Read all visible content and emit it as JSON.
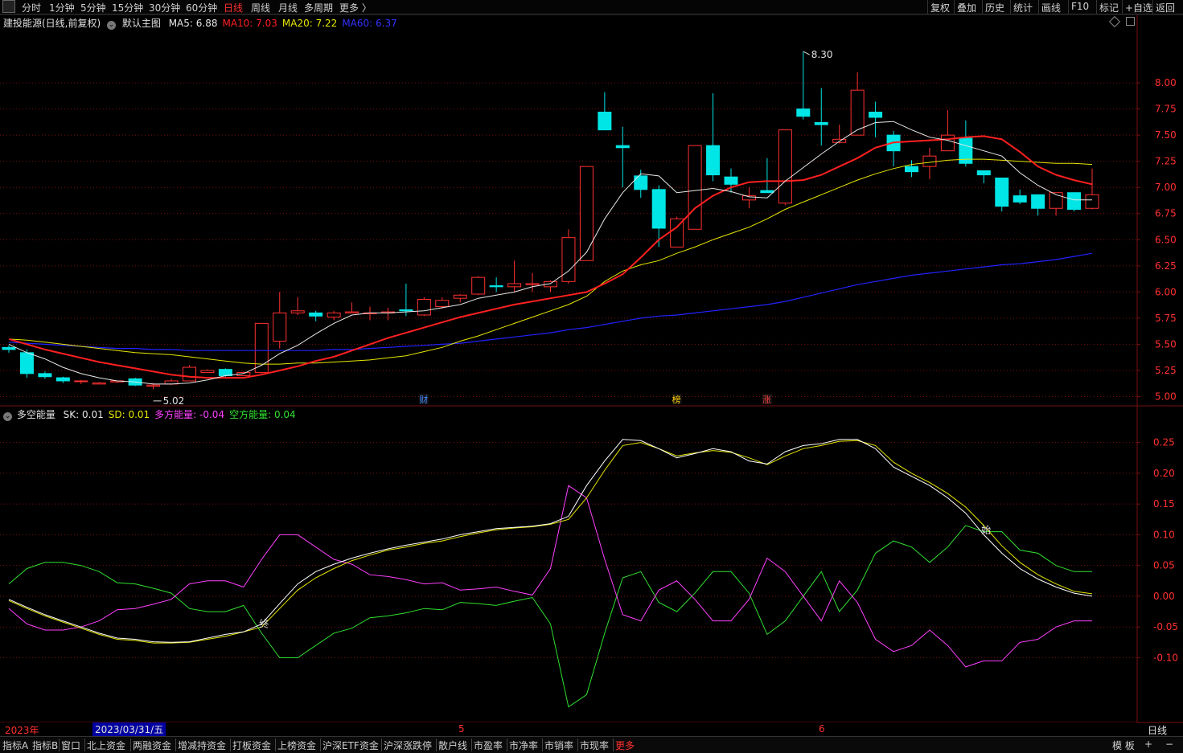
{
  "toolbar": {
    "left_tabs": [
      "分时",
      "1分钟",
      "5分钟",
      "15分钟",
      "30分钟",
      "60分钟",
      "日线",
      "周线",
      "月线",
      "多周期",
      "更多 〉"
    ],
    "active_tab": "日线",
    "right_tabs": [
      "复权",
      "叠加",
      "历史",
      "统计",
      "画线",
      "F10",
      "标记",
      "+自选",
      "返回"
    ]
  },
  "main": {
    "stock_name": "建投能源(日线,前复权)",
    "template": "默认主图",
    "ma": [
      {
        "label": "MA5: 6.88",
        "color": "#e8e8e8"
      },
      {
        "label": "MA10: 7.03",
        "color": "#ff2020"
      },
      {
        "label": "MA20: 7.22",
        "color": "#e6e600"
      },
      {
        "label": "MA60: 6.37",
        "color": "#3333ff"
      }
    ],
    "high_label": "8.30",
    "low_label": "5.02",
    "markers": [
      {
        "text": "财",
        "color": "#4488ff"
      },
      {
        "text": "榜",
        "color": "#ffcc00"
      },
      {
        "text": "涨",
        "color": "#ff4040"
      }
    ]
  },
  "sub": {
    "title": "多空能量",
    "items": [
      {
        "label": "SK: 0.01",
        "color": "#e8e8e8"
      },
      {
        "label": "SD: 0.01",
        "color": "#e6e600"
      },
      {
        "label": "多方能量: -0.04",
        "color": "#ff40ff"
      },
      {
        "label": "空方能量: 0.04",
        "color": "#30e030"
      }
    ],
    "annotations": [
      "终",
      "始"
    ]
  },
  "date_axis": {
    "year": "2023年",
    "cursor_date": "2023/03/31/五",
    "months": [
      "5",
      "6"
    ],
    "period": "日线"
  },
  "bottombar": {
    "items": [
      "指标A",
      "指标B",
      "窗口",
      "北上资金",
      "两融资金",
      "增减持资金",
      "打板资金",
      "上榜资金",
      "沪深ETF资金",
      "沪深涨跌停",
      "散户线",
      "市盈率",
      "市净率",
      "市销率",
      "市现率",
      "更多"
    ],
    "right": [
      "模 板",
      "+",
      "−"
    ]
  },
  "colors": {
    "up": "#ff3030",
    "down": "#00e5e5",
    "grid": "#7a1010",
    "axis_text": "#ff3030",
    "ma5": "#e8e8e8",
    "ma10": "#ff2020",
    "ma20": "#e6e600",
    "ma60": "#2222ff",
    "sk": "#ffffff",
    "sd": "#e6e600",
    "bull": "#ff40ff",
    "bear": "#30e030"
  },
  "chart_data": [
    {
      "type": "candlestick",
      "title": "建投能源(日线,前复权)",
      "y_ticks": [
        8.0,
        7.75,
        7.5,
        7.25,
        7.0,
        6.75,
        6.5,
        6.25,
        6.0,
        5.75,
        5.5,
        5.25,
        5.0
      ],
      "ylim": [
        4.95,
        8.5
      ],
      "candles": [
        [
          5.47,
          5.45,
          5.49,
          5.42
        ],
        [
          5.42,
          5.22,
          5.45,
          5.18
        ],
        [
          5.22,
          5.19,
          5.24,
          5.17
        ],
        [
          5.18,
          5.15,
          5.19,
          5.13
        ],
        [
          5.15,
          5.15,
          5.16,
          5.12
        ],
        [
          5.12,
          5.13,
          5.14,
          5.12
        ],
        [
          5.14,
          5.15,
          5.15,
          5.13
        ],
        [
          5.17,
          5.11,
          5.18,
          5.1
        ],
        [
          5.1,
          5.11,
          5.13,
          5.07
        ],
        [
          5.12,
          5.15,
          5.17,
          5.11
        ],
        [
          5.15,
          5.28,
          5.3,
          5.15
        ],
        [
          5.23,
          5.25,
          5.26,
          5.23
        ],
        [
          5.26,
          5.2,
          5.27,
          5.19
        ],
        [
          5.2,
          5.23,
          5.24,
          5.2
        ],
        [
          5.23,
          5.7,
          5.7,
          5.22
        ],
        [
          5.53,
          5.8,
          6.0,
          5.46
        ],
        [
          5.8,
          5.82,
          5.95,
          5.78
        ],
        [
          5.8,
          5.77,
          5.82,
          5.72
        ],
        [
          5.76,
          5.8,
          5.82,
          5.73
        ],
        [
          5.8,
          5.81,
          5.9,
          5.8
        ],
        [
          5.8,
          5.8,
          5.86,
          5.73
        ],
        [
          5.8,
          5.81,
          5.85,
          5.73
        ],
        [
          5.83,
          5.82,
          6.08,
          5.77
        ],
        [
          5.78,
          5.93,
          5.95,
          5.77
        ],
        [
          5.86,
          5.92,
          5.95,
          5.84
        ],
        [
          5.94,
          5.97,
          5.98,
          5.9
        ],
        [
          5.98,
          6.14,
          6.15,
          5.97
        ],
        [
          6.06,
          6.05,
          6.14,
          6.0
        ],
        [
          6.05,
          6.08,
          6.3,
          6.0
        ],
        [
          6.07,
          6.08,
          6.18,
          6.0
        ],
        [
          6.05,
          6.1,
          6.11,
          6.0
        ],
        [
          6.1,
          6.52,
          6.6,
          6.08
        ],
        [
          6.3,
          7.2,
          7.2,
          6.3
        ],
        [
          7.72,
          7.55,
          7.91,
          7.55
        ],
        [
          7.4,
          7.38,
          7.58,
          7.0
        ],
        [
          7.11,
          6.98,
          7.17,
          6.9
        ],
        [
          6.98,
          6.61,
          7.02,
          6.43
        ],
        [
          6.43,
          6.7,
          6.72,
          6.48
        ],
        [
          6.6,
          7.4,
          7.4,
          6.6
        ],
        [
          7.4,
          7.12,
          7.9,
          7.06
        ],
        [
          7.1,
          7.03,
          7.18,
          6.95
        ],
        [
          6.88,
          6.92,
          7.0,
          6.8
        ],
        [
          6.97,
          6.95,
          7.28,
          6.95
        ],
        [
          6.85,
          7.55,
          7.5,
          6.83
        ],
        [
          7.75,
          7.68,
          8.3,
          7.65
        ],
        [
          7.62,
          7.6,
          7.95,
          7.4
        ],
        [
          7.43,
          7.46,
          7.6,
          7.42
        ],
        [
          7.5,
          7.93,
          8.1,
          7.5
        ],
        [
          7.72,
          7.67,
          7.82,
          7.48
        ],
        [
          7.5,
          7.35,
          7.54,
          7.2
        ],
        [
          7.2,
          7.15,
          7.26,
          7.1
        ],
        [
          7.2,
          7.3,
          7.38,
          7.08
        ],
        [
          7.35,
          7.5,
          7.74,
          7.36
        ],
        [
          7.47,
          7.23,
          7.64,
          7.2
        ],
        [
          7.16,
          7.12,
          7.16,
          7.04
        ],
        [
          7.09,
          6.82,
          7.09,
          6.77
        ],
        [
          6.92,
          6.86,
          6.98,
          6.84
        ],
        [
          6.93,
          6.8,
          6.93,
          6.73
        ],
        [
          6.8,
          6.95,
          6.95,
          6.73
        ],
        [
          6.95,
          6.79,
          6.95,
          6.77
        ],
        [
          6.8,
          6.93,
          7.18,
          6.79
        ]
      ],
      "ma5": [
        5.5,
        5.42,
        5.36,
        5.28,
        5.22,
        5.18,
        5.15,
        5.14,
        5.12,
        5.12,
        5.13,
        5.16,
        5.2,
        5.22,
        5.3,
        5.41,
        5.49,
        5.6,
        5.7,
        5.78,
        5.8,
        5.8,
        5.81,
        5.82,
        5.85,
        5.88,
        5.94,
        5.97,
        6.0,
        6.05,
        6.08,
        6.2,
        6.38,
        6.7,
        6.95,
        7.13,
        7.11,
        6.95,
        6.97,
        6.99,
        6.96,
        6.91,
        6.9,
        7.06,
        7.19,
        7.32,
        7.44,
        7.55,
        7.62,
        7.63,
        7.55,
        7.48,
        7.45,
        7.4,
        7.35,
        7.3,
        7.14,
        7.02,
        6.93,
        6.88,
        6.88
      ],
      "ma10": [
        5.55,
        5.5,
        5.45,
        5.41,
        5.37,
        5.33,
        5.3,
        5.27,
        5.24,
        5.21,
        5.19,
        5.18,
        5.18,
        5.18,
        5.21,
        5.25,
        5.29,
        5.34,
        5.38,
        5.44,
        5.5,
        5.56,
        5.61,
        5.66,
        5.71,
        5.76,
        5.8,
        5.84,
        5.88,
        5.91,
        5.94,
        5.97,
        6.0,
        6.08,
        6.17,
        6.33,
        6.5,
        6.62,
        6.8,
        6.92,
        7.0,
        7.05,
        7.06,
        7.06,
        7.07,
        7.12,
        7.2,
        7.28,
        7.38,
        7.43,
        7.44,
        7.45,
        7.46,
        7.48,
        7.49,
        7.46,
        7.34,
        7.2,
        7.12,
        7.07,
        7.03
      ],
      "ma20": [
        5.55,
        5.54,
        5.52,
        5.5,
        5.48,
        5.46,
        5.44,
        5.42,
        5.41,
        5.4,
        5.38,
        5.36,
        5.34,
        5.32,
        5.31,
        5.31,
        5.32,
        5.32,
        5.33,
        5.34,
        5.35,
        5.37,
        5.39,
        5.43,
        5.47,
        5.53,
        5.58,
        5.64,
        5.7,
        5.76,
        5.82,
        5.88,
        5.96,
        6.1,
        6.2,
        6.26,
        6.3,
        6.37,
        6.43,
        6.5,
        6.56,
        6.62,
        6.7,
        6.79,
        6.86,
        6.93,
        7.0,
        7.07,
        7.13,
        7.18,
        7.22,
        7.24,
        7.26,
        7.27,
        7.27,
        7.26,
        7.25,
        7.24,
        7.23,
        7.23,
        7.22
      ],
      "ma60": [
        5.52,
        5.51,
        5.5,
        5.49,
        5.48,
        5.47,
        5.46,
        5.46,
        5.45,
        5.45,
        5.44,
        5.44,
        5.44,
        5.44,
        5.44,
        5.44,
        5.44,
        5.44,
        5.45,
        5.45,
        5.46,
        5.47,
        5.48,
        5.49,
        5.5,
        5.51,
        5.53,
        5.55,
        5.57,
        5.59,
        5.61,
        5.64,
        5.66,
        5.69,
        5.72,
        5.75,
        5.77,
        5.78,
        5.8,
        5.82,
        5.84,
        5.86,
        5.88,
        5.91,
        5.95,
        5.99,
        6.03,
        6.07,
        6.1,
        6.13,
        6.16,
        6.18,
        6.2,
        6.22,
        6.24,
        6.26,
        6.27,
        6.29,
        6.31,
        6.34,
        6.37
      ]
    },
    {
      "type": "line",
      "title": "多空能量",
      "y_ticks": [
        0.25,
        0.2,
        0.15,
        0.1,
        0.05,
        -0.0,
        -0.05,
        -0.1
      ],
      "ylim": [
        -0.2,
        0.29
      ],
      "x_index": [
        0,
        1,
        2,
        3,
        4,
        5,
        6,
        7,
        8,
        9,
        10,
        11,
        12,
        13,
        14,
        15,
        16,
        17,
        18,
        19,
        20,
        21,
        22,
        23,
        24,
        25,
        26,
        27,
        28,
        29,
        30,
        31,
        32,
        33,
        34,
        35,
        36,
        37,
        38,
        39,
        40,
        41,
        42,
        43,
        44,
        45,
        46,
        47,
        48,
        49,
        50,
        51,
        52,
        53,
        54,
        55,
        56,
        57,
        58,
        59,
        60
      ],
      "series": [
        {
          "name": "SK",
          "values": [
            -0.005,
            -0.018,
            -0.03,
            -0.04,
            -0.05,
            -0.06,
            -0.068,
            -0.07,
            -0.074,
            -0.075,
            -0.074,
            -0.068,
            -0.062,
            -0.058,
            -0.045,
            -0.012,
            0.02,
            0.04,
            0.052,
            0.062,
            0.07,
            0.077,
            0.083,
            0.088,
            0.093,
            0.1,
            0.105,
            0.11,
            0.112,
            0.114,
            0.118,
            0.13,
            0.18,
            0.22,
            0.255,
            0.253,
            0.24,
            0.225,
            0.232,
            0.24,
            0.235,
            0.22,
            0.215,
            0.235,
            0.245,
            0.248,
            0.255,
            0.255,
            0.24,
            0.21,
            0.195,
            0.18,
            0.16,
            0.135,
            0.1,
            0.07,
            0.045,
            0.028,
            0.015,
            0.005,
            0.0
          ]
        },
        {
          "name": "SD",
          "values": [
            -0.007,
            -0.02,
            -0.032,
            -0.042,
            -0.052,
            -0.062,
            -0.07,
            -0.072,
            -0.076,
            -0.076,
            -0.075,
            -0.07,
            -0.065,
            -0.058,
            -0.05,
            -0.02,
            0.01,
            0.03,
            0.045,
            0.058,
            0.067,
            0.075,
            0.08,
            0.086,
            0.09,
            0.097,
            0.103,
            0.108,
            0.111,
            0.113,
            0.117,
            0.125,
            0.16,
            0.205,
            0.245,
            0.25,
            0.24,
            0.228,
            0.233,
            0.237,
            0.234,
            0.225,
            0.214,
            0.228,
            0.24,
            0.245,
            0.252,
            0.253,
            0.245,
            0.218,
            0.2,
            0.185,
            0.167,
            0.145,
            0.115,
            0.082,
            0.055,
            0.035,
            0.02,
            0.008,
            0.004
          ]
        },
        {
          "name": "多方能量",
          "values": [
            -0.02,
            -0.045,
            -0.055,
            -0.055,
            -0.05,
            -0.04,
            -0.022,
            -0.02,
            -0.013,
            -0.005,
            0.02,
            0.025,
            0.025,
            0.015,
            0.06,
            0.1,
            0.1,
            0.08,
            0.06,
            0.052,
            0.035,
            0.032,
            0.027,
            0.02,
            0.022,
            0.01,
            0.012,
            0.015,
            0.008,
            0.002,
            0.045,
            0.18,
            0.16,
            0.06,
            -0.03,
            -0.04,
            0.01,
            0.025,
            -0.005,
            -0.04,
            -0.04,
            -0.005,
            0.062,
            0.04,
            0.0,
            -0.04,
            0.025,
            -0.01,
            -0.07,
            -0.09,
            -0.08,
            -0.055,
            -0.08,
            -0.115,
            -0.105,
            -0.105,
            -0.075,
            -0.07,
            -0.05,
            -0.04,
            -0.04
          ]
        },
        {
          "name": "空方能量",
          "values": [
            0.02,
            0.045,
            0.055,
            0.055,
            0.05,
            0.04,
            0.022,
            0.02,
            0.013,
            0.005,
            -0.02,
            -0.025,
            -0.025,
            -0.015,
            -0.06,
            -0.1,
            -0.1,
            -0.08,
            -0.06,
            -0.052,
            -0.035,
            -0.032,
            -0.027,
            -0.02,
            -0.022,
            -0.01,
            -0.012,
            -0.015,
            -0.008,
            -0.002,
            -0.045,
            -0.18,
            -0.16,
            -0.06,
            0.03,
            0.04,
            -0.01,
            -0.025,
            0.005,
            0.04,
            0.04,
            0.005,
            -0.062,
            -0.04,
            0.0,
            0.04,
            -0.025,
            0.01,
            0.07,
            0.09,
            0.08,
            0.055,
            0.08,
            0.115,
            0.105,
            0.105,
            0.075,
            0.07,
            0.05,
            0.04,
            0.04
          ]
        }
      ]
    }
  ]
}
